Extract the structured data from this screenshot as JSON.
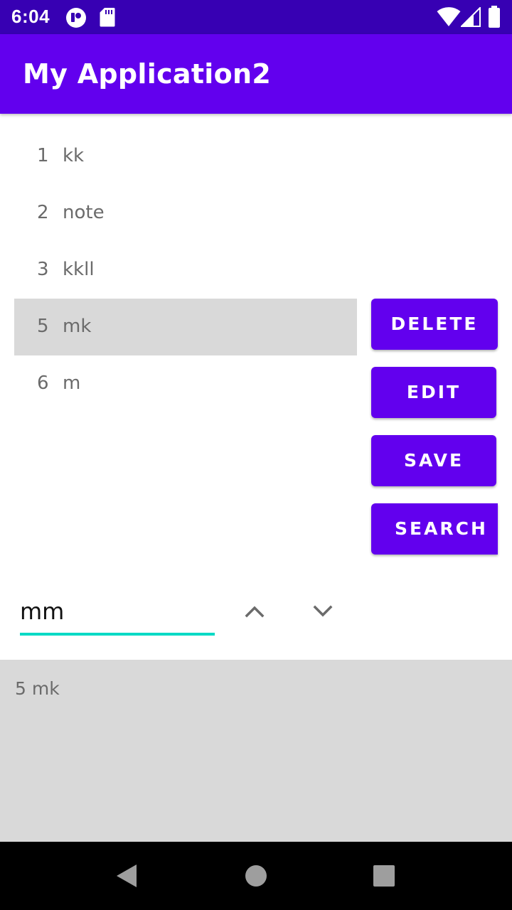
{
  "status_bar": {
    "time": "6:04",
    "icons": [
      "app-notification-icon",
      "sd-card-icon",
      "wifi-icon",
      "cell-signal-icon",
      "battery-icon"
    ]
  },
  "app_bar": {
    "title": "My Application2"
  },
  "notes": [
    {
      "id": "1",
      "text": "kk",
      "selected": false
    },
    {
      "id": "2",
      "text": "note",
      "selected": false
    },
    {
      "id": "3",
      "text": "kkll",
      "selected": false
    },
    {
      "id": "5",
      "text": "mk",
      "selected": true
    },
    {
      "id": "6",
      "text": "m",
      "selected": false
    }
  ],
  "actions": {
    "delete_label": "DELETE",
    "edit_label": "EDIT",
    "save_label": "SAVE",
    "search_label": "SEARCH"
  },
  "search": {
    "value": "mm",
    "up_icon": "chevron-up-icon",
    "down_icon": "chevron-down-icon"
  },
  "result": {
    "text": "5 mk"
  },
  "nav": {
    "icons": [
      "back-icon",
      "home-icon",
      "recents-icon"
    ]
  },
  "colors": {
    "status_bar": "#3700b3",
    "primary": "#6200ee",
    "accent": "#03dac5",
    "selected_row": "#d9d9d9"
  }
}
